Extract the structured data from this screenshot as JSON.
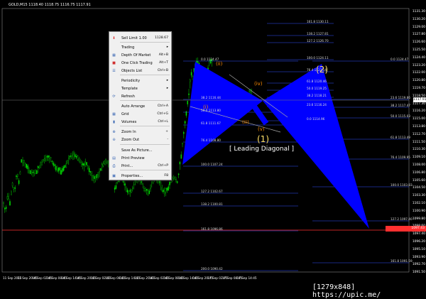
{
  "header": {
    "title": "GOLD,M15  1118.40 1118.75 1116.75 1117.91"
  },
  "price_axis": [
    "1131.30",
    "1130.20",
    "1129.00",
    "1127.80",
    "1126.60",
    "1125.50",
    "1124.40",
    "1123.20",
    "1122.00",
    "1120.80",
    "1119.70",
    "1118.50",
    "1117.30",
    "1116.20",
    "1115.00",
    "1113.80",
    "1112.70",
    "1111.50",
    "1110.30",
    "1109.10",
    "1108.00",
    "1106.80",
    "1105.60",
    "1104.50",
    "1103.30",
    "1102.10",
    "1100.90",
    "1099.80",
    "1098.60",
    "1097.40",
    "1096.20",
    "1095.10",
    "1093.90",
    "1092.70",
    "1091.50"
  ],
  "time_axis": [
    "11 Sep 2015",
    "11 Sep 20:45",
    "14 Sep 02:45",
    "14 Sep 08:45",
    "14 Sep 14:45",
    "14 Sep 20:45",
    "15 Sep 02:45",
    "15 Sep 08:45",
    "15 Sep 14:45",
    "15 Sep 20:45",
    "16 Sep 02:45",
    "16 Sep 08:45",
    "16 Sep 14:45",
    "16 Sep 20:45",
    "17 Sep 02:45",
    "17 Sep 08:45",
    "17 Sep 14:45"
  ],
  "current_price": "1117.91",
  "price_marker": "1097.43",
  "fib_left": [
    "0.0  1124.47",
    "38.2  1116.44",
    "50.0  1113.80",
    "61.8  1111.67",
    "76.4  1108.80",
    "100.0  1107.24",
    "127.2  1102.67",
    "138.2  1100.81",
    "161.8  1096.86",
    "200.0  1090.42"
  ],
  "fib_right_upper": [
    "161.8  1130.11",
    "138.2  1127.81",
    "127.2  1126.70",
    "100.0  1124.11",
    "76.4  1122.14",
    "61.8  1120.46",
    "50.0  1119.25",
    "38.2  1118.21",
    "23.6  1116.24",
    "0.0  1114.96"
  ],
  "fib_far_right": [
    "0.0  1124.47",
    "23.6  1119.86",
    "38.2  1117.47",
    "50.0  1115.03",
    "61.8  1113.49",
    "76.4  1109.95",
    "100.0  1103.83",
    "127.2  1097.40",
    "161.8  1091.59"
  ],
  "waves": {
    "i": "(i)",
    "ii": "(ii)",
    "iii": "(iii)",
    "iv": "(iv)",
    "v": "(v)",
    "one": "(1)",
    "two": "(2)"
  },
  "annotation": "[ Leading Diagonal ]",
  "colors": {
    "candle": "#00dd00",
    "pattern": "#0000ff",
    "fib": "#3050ff",
    "wave_orange": "#ff8c00",
    "wave_yellow": "#ffe066",
    "marker": "#ff3030"
  },
  "context_menu": {
    "items": [
      {
        "icon": "sell-limit-icon",
        "label": "Sell Limit 1.00",
        "shortcut": "1128.67"
      },
      {
        "label": "Trading",
        "submenu": "▸"
      },
      {
        "icon": "depth-of-market-icon",
        "label": "Depth Of Market",
        "shortcut": "Alt+B"
      },
      {
        "icon": "one-click-icon",
        "label": "One Click Trading",
        "shortcut": "Alt+T"
      },
      {
        "icon": "objects-list-icon",
        "label": "Objects List",
        "shortcut": "Ctrl+B"
      },
      {
        "label": "Periodicity",
        "submenu": "▸"
      },
      {
        "label": "Template",
        "submenu": "▸"
      },
      {
        "icon": "refresh-icon",
        "label": "Refresh"
      },
      {
        "label": "Auto Arrange",
        "shortcut": "Ctrl+A"
      },
      {
        "icon": "grid-icon",
        "label": "Grid",
        "shortcut": "Ctrl+G"
      },
      {
        "icon": "volumes-icon",
        "label": "Volumes",
        "shortcut": "Ctrl+L"
      },
      {
        "icon": "zoom-in-icon",
        "label": "Zoom In",
        "shortcut": "+"
      },
      {
        "icon": "zoom-out-icon",
        "label": "Zoom Out",
        "shortcut": "-"
      },
      {
        "label": "Save As Picture..."
      },
      {
        "icon": "print-preview-icon",
        "label": "Print Preview"
      },
      {
        "icon": "print-icon",
        "label": "Print...",
        "shortcut": "Ctrl+P"
      },
      {
        "icon": "properties-icon",
        "label": "Properties...",
        "shortcut": "F8"
      }
    ]
  },
  "watermark": "[1279x848] https://upic.me/"
}
